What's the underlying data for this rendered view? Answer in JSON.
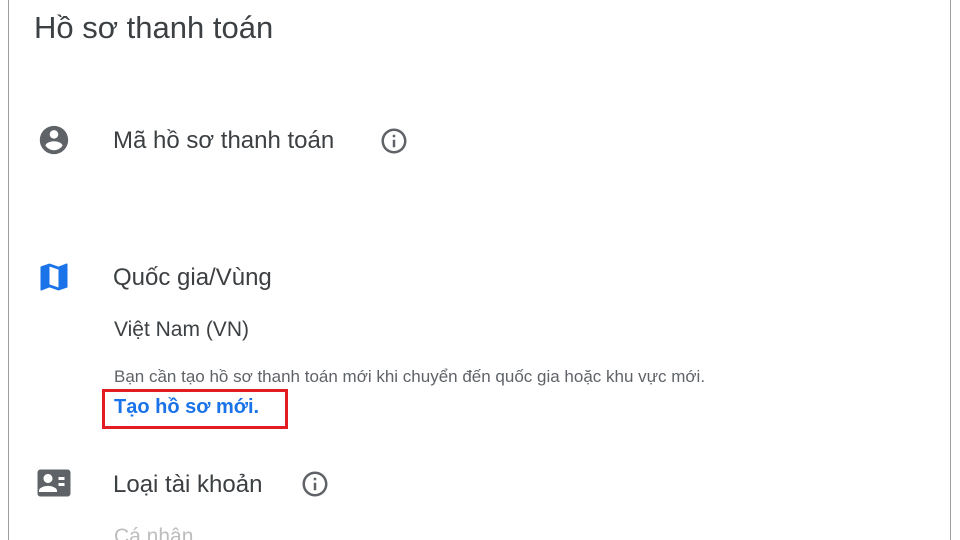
{
  "page": {
    "title": "Hồ sơ thanh toán"
  },
  "sections": {
    "profile_id": {
      "label": "Mã hồ sơ thanh toán",
      "icon": "account-circle-icon"
    },
    "country": {
      "label": "Quốc gia/Vùng",
      "icon": "map-icon",
      "value": "Việt Nam (VN)",
      "note": "Bạn cần tạo hồ sơ thanh toán mới khi chuyển đến quốc gia hoặc khu vực mới.",
      "link": "Tạo hồ sơ mới."
    },
    "account_type": {
      "label": "Loại tài khoản",
      "icon": "contact-card-icon",
      "value": "Cá nhân"
    }
  },
  "colors": {
    "text": "#3c4043",
    "icon": "#5f6368",
    "map_icon": "#1a73e8",
    "link": "#1a73e8",
    "highlight": "#e31b23"
  }
}
